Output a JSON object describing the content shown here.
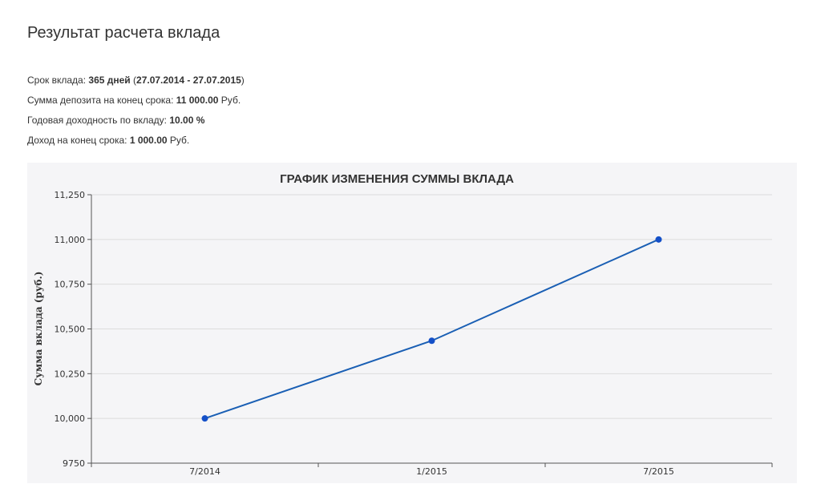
{
  "page": {
    "title": "Результат расчета вклада"
  },
  "summary": [
    {
      "label": "Срок вклада: ",
      "value": "365 дней",
      "suffix": " (",
      "value2": "27.07.2014 - 27.07.2015",
      "suffix2": ")"
    },
    {
      "label": "Сумма депозита на конец срока: ",
      "value": "11 000.00",
      "suffix": " Руб.",
      "value2": "",
      "suffix2": ""
    },
    {
      "label": "Годовая доходность по вкладу: ",
      "value": "10.00 %",
      "suffix": "",
      "value2": "",
      "suffix2": ""
    },
    {
      "label": "Доход на конец срока: ",
      "value": "1 000.00",
      "suffix": " Руб.",
      "value2": "",
      "suffix2": ""
    }
  ],
  "chart_data": {
    "type": "line",
    "title": "ГРАФИК ИЗМЕНЕНИЯ СУММЫ ВКЛАДА",
    "xlabel": "",
    "ylabel": "Сумма вклада (руб.)",
    "categories": [
      "7/2014",
      "1/2015",
      "7/2015"
    ],
    "series": [
      {
        "values": [
          10000,
          10434,
          11000
        ]
      }
    ],
    "ylim": [
      9750,
      11250
    ],
    "yticks": [
      "9750",
      "10,000",
      "10,250",
      "10,500",
      "10,750",
      "11,000",
      "11,250"
    ],
    "ytick_values": [
      9750,
      10000,
      10250,
      10500,
      10750,
      11000,
      11250
    ],
    "grid": true,
    "colors": {
      "line": "#1a5fb4",
      "point": "#1450c8",
      "grid": "#dcdcdc",
      "axis": "#555555"
    }
  }
}
